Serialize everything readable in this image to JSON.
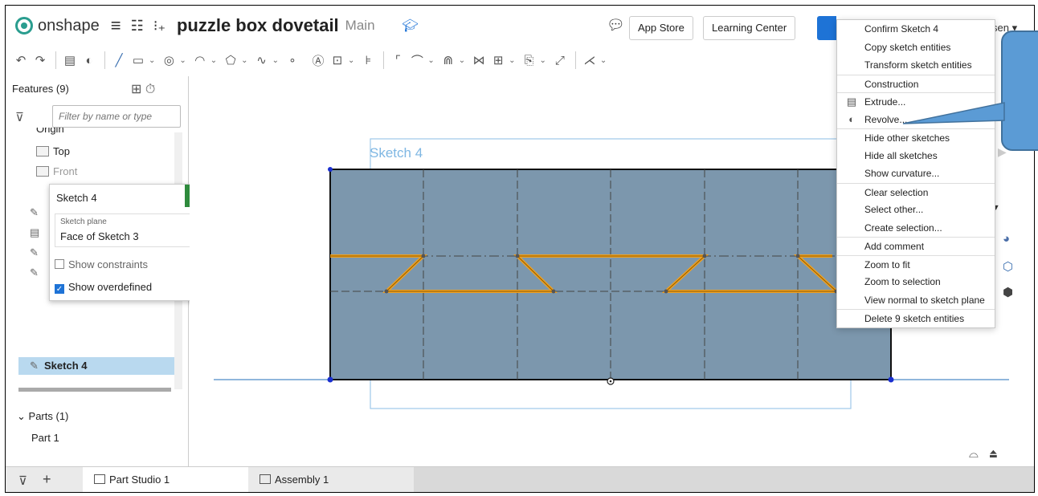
{
  "header": {
    "app_name": "onshape",
    "document_name": "puzzle box dovetail",
    "branch": "Main",
    "app_store": "App Store",
    "learning_center": "Learning Center",
    "user_partial": "sen"
  },
  "features": {
    "header": "Features (9)",
    "filter_placeholder": "Filter by name or type",
    "items": [
      {
        "label": "Origin"
      },
      {
        "label": "Top"
      },
      {
        "label": "Front"
      },
      {
        "label": "Sketch 4"
      }
    ],
    "parts_header": "Parts (1)",
    "parts": [
      {
        "label": "Part 1"
      }
    ]
  },
  "sketch_dialog": {
    "title": "Sketch 4",
    "plane_label": "Sketch plane",
    "plane_value": "Face of Sketch 3",
    "show_constraints": "Show constraints",
    "show_overdefined": "Show overdefined",
    "show_overdefined_checked": true,
    "show_constraints_checked": false
  },
  "viewport": {
    "sketch_label": "Sketch 4"
  },
  "context_menu": {
    "items": [
      {
        "label": "Confirm Sketch 4",
        "icon": "",
        "sep": false
      },
      {
        "label": "Copy sketch entities",
        "icon": "",
        "sep": false
      },
      {
        "label": "Transform sketch entities",
        "icon": "",
        "sep": false
      },
      {
        "label": "Construction",
        "icon": "",
        "sep": true
      },
      {
        "label": "Extrude...",
        "icon": "extrude-icon",
        "sep": true
      },
      {
        "label": "Revolve...",
        "icon": "revolve-icon",
        "sep": false
      },
      {
        "label": "Hide other sketches",
        "icon": "",
        "sep": true
      },
      {
        "label": "Hide all sketches",
        "icon": "",
        "sep": false
      },
      {
        "label": "Show curvature...",
        "icon": "",
        "sep": false
      },
      {
        "label": "Clear selection",
        "icon": "",
        "sep": true
      },
      {
        "label": "Select other...",
        "icon": "",
        "sep": false
      },
      {
        "label": "Create selection...",
        "icon": "",
        "sep": false
      },
      {
        "label": "Add comment",
        "icon": "",
        "sep": true
      },
      {
        "label": "Zoom to fit",
        "icon": "",
        "sep": true
      },
      {
        "label": "Zoom to selection",
        "icon": "",
        "sep": false
      },
      {
        "label": "View normal to sketch plane",
        "icon": "",
        "sep": false
      },
      {
        "label": "Delete 9 sketch entities",
        "icon": "",
        "sep": true
      }
    ]
  },
  "tabs": {
    "part_studio": "Part Studio 1",
    "assembly": "Assembly 1"
  },
  "colors": {
    "accent": "#1e73d6",
    "sketch_fill": "#7c97ad",
    "sketch_highlight": "#f0a020",
    "callout": "#5b9bd5"
  }
}
